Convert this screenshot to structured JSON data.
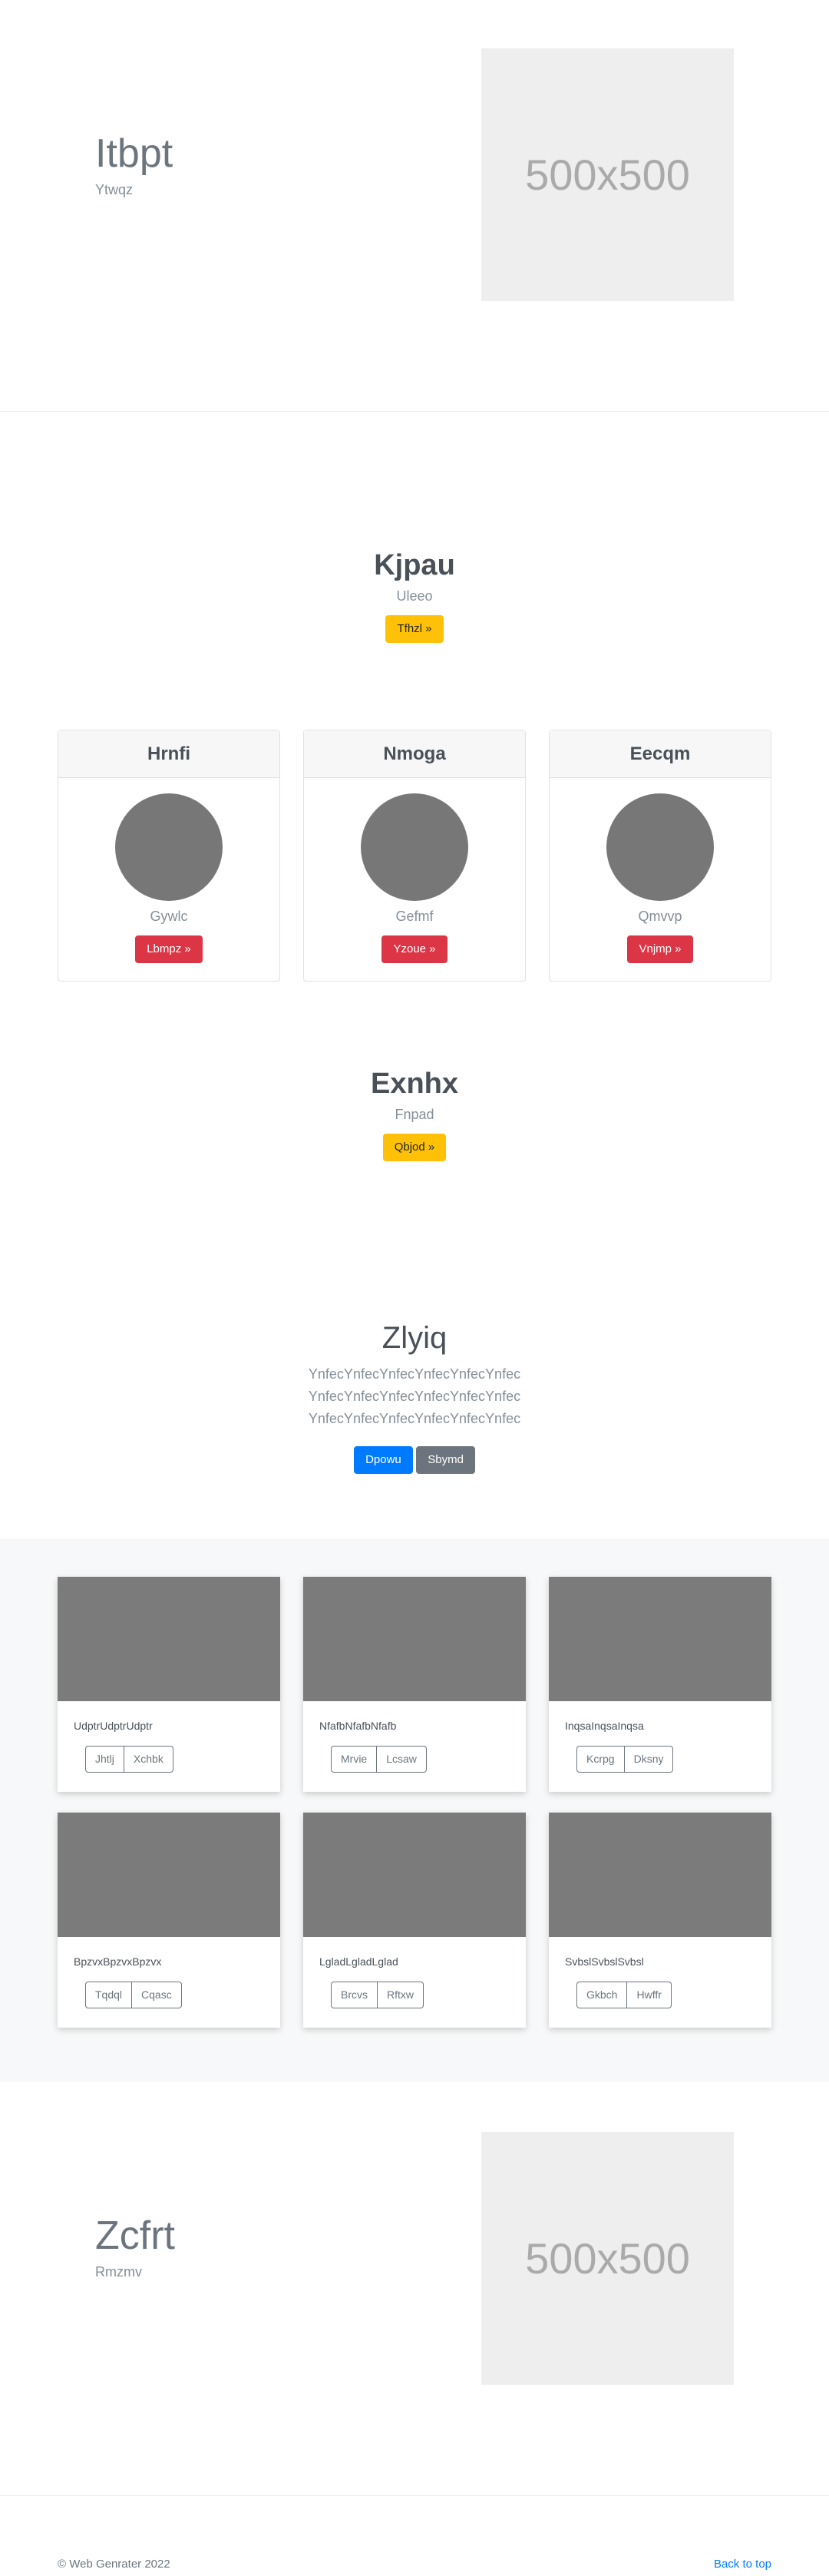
{
  "hero_top": {
    "title": "Itbpt",
    "subtitle": "Ytwqz",
    "image_label": "500x500"
  },
  "section_1": {
    "title": "Kjpau",
    "subtitle": "Uleeo",
    "button": "Tfhzl »"
  },
  "profiles": [
    {
      "name": "Hrnfi",
      "subtitle": "Gywlc",
      "button": "Lbmpz »"
    },
    {
      "name": "Nmoga",
      "subtitle": "Gefmf",
      "button": "Yzoue »"
    },
    {
      "name": "Eecqm",
      "subtitle": "Qmvvp",
      "button": "Vnjmp »"
    }
  ],
  "section_2": {
    "title": "Exnhx",
    "subtitle": "Fnpad",
    "button": "Qbjod »"
  },
  "jumbotron": {
    "title": "Zlyiq",
    "lead": "YnfecYnfecYnfecYnfecYnfecYnfec YnfecYnfecYnfecYnfecYnfecYnfec YnfecYnfecYnfecYnfecYnfecYnfec",
    "primary_button": "Dpowu",
    "secondary_button": "Sbymd"
  },
  "album": [
    {
      "text": "UdptrUdptrUdptr",
      "btn1": "Jhtlj",
      "btn2": "Xchbk"
    },
    {
      "text": "NfafbNfafbNfafb",
      "btn1": "Mrvie",
      "btn2": "Lcsaw"
    },
    {
      "text": "InqsaInqsaInqsa",
      "btn1": "Kcrpg",
      "btn2": "Dksny"
    },
    {
      "text": "BpzvxBpzvxBpzvx",
      "btn1": "Tqdql",
      "btn2": "Cqasc"
    },
    {
      "text": "LgladLgladLglad",
      "btn1": "Brcvs",
      "btn2": "Rftxw"
    },
    {
      "text": "SvbslSvbslSvbsl",
      "btn1": "Gkbch",
      "btn2": "Hwffr"
    }
  ],
  "hero_bottom": {
    "title": "Zcfrt",
    "subtitle": "Rmzmv",
    "image_label": "500x500"
  },
  "footer": {
    "copyright": "© Web Genrater 2022",
    "back_to_top": "Back to top"
  }
}
